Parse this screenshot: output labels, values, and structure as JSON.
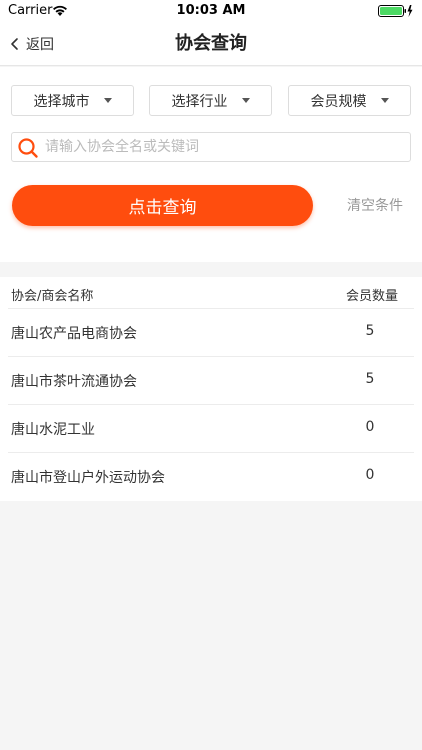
{
  "status_bar": {
    "carrier": "Carrier",
    "time": "10:03 AM"
  },
  "nav": {
    "back_label": "返回",
    "title": "协会查询"
  },
  "filters": {
    "city": "选择城市",
    "industry": "选择行业",
    "member_scale": "会员规模"
  },
  "search": {
    "placeholder": "请输入协会全名或关键词",
    "value": ""
  },
  "actions": {
    "query_label": "点击查询",
    "clear_label": "清空条件"
  },
  "table": {
    "headers": {
      "name": "协会/商会名称",
      "count": "会员数量"
    },
    "rows": [
      {
        "name": "唐山农产品电商协会",
        "count": "5"
      },
      {
        "name": "唐山市茶叶流通协会",
        "count": "5"
      },
      {
        "name": "唐山水泥工业",
        "count": "0"
      },
      {
        "name": "唐山市登山户外运动协会",
        "count": "0"
      }
    ]
  },
  "colors": {
    "accent": "#ff4d0e",
    "page_bg": "#f5f5f5"
  }
}
